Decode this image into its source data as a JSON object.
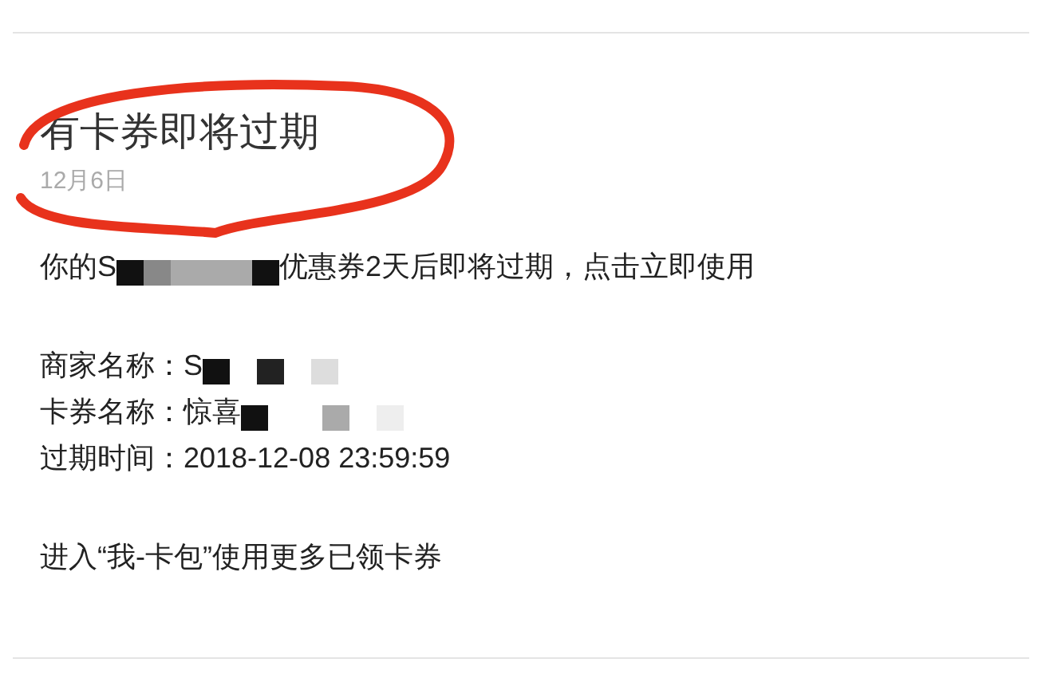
{
  "notification": {
    "title": "有卡券即将过期",
    "date": "12月6日",
    "annotated": true
  },
  "message": {
    "paragraphs": [
      {
        "lines": [
          {
            "text": "你的S",
            "redacted": true,
            "after": "优惠券2天后即将过期，点击立即使用"
          }
        ]
      },
      {
        "lines": [
          {
            "text": "商家名称：S",
            "redacted": true
          },
          {
            "text": "卡券名称：惊喜",
            "redacted": true
          },
          {
            "text": "过期时间：2018-12-08 23:59:59",
            "redacted": false
          }
        ]
      },
      {
        "lines": [
          {
            "text": "进入“我-卡包”使用更多已领卡券",
            "redacted": false
          }
        ]
      }
    ]
  }
}
